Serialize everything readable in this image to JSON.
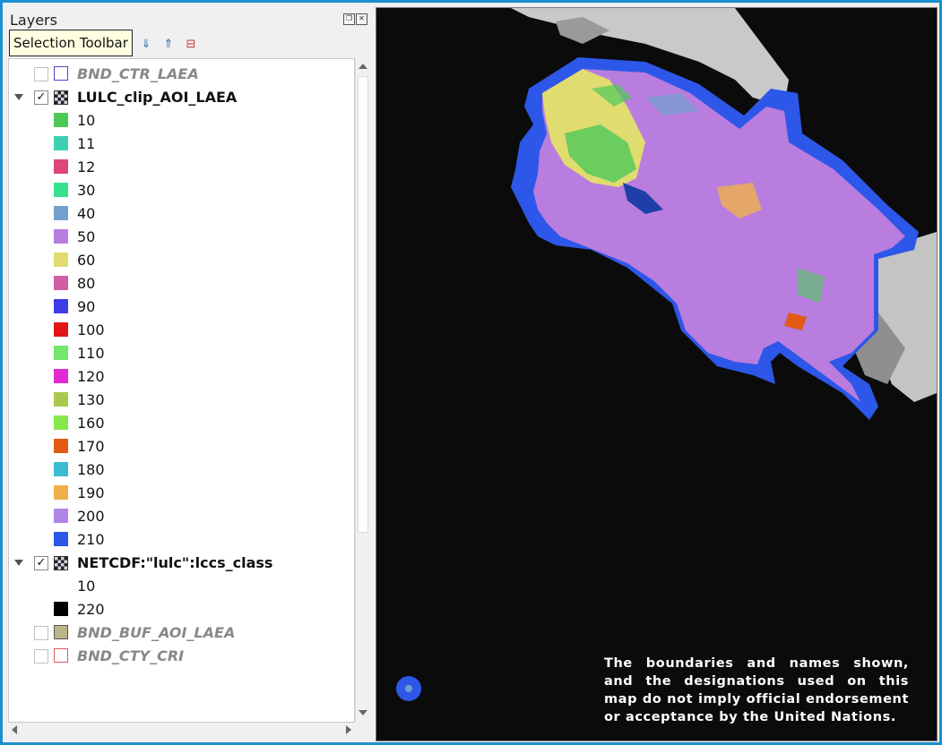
{
  "panel": {
    "title": "Layers",
    "tooltip": "Selection Toolbar"
  },
  "layers": {
    "bnd_ctr": {
      "name": "BND_CTR_LAEA",
      "checked": false,
      "symbol_color": "#5b3fd0"
    },
    "lulc": {
      "name": "LULC_clip_AOI_LAEA",
      "checked": true,
      "classes": [
        {
          "label": "10",
          "color": "#4dc95a"
        },
        {
          "label": "11",
          "color": "#3fcfb2"
        },
        {
          "label": "12",
          "color": "#de4676"
        },
        {
          "label": "30",
          "color": "#37e08c"
        },
        {
          "label": "40",
          "color": "#74a0cf"
        },
        {
          "label": "50",
          "color": "#b87ddf"
        },
        {
          "label": "60",
          "color": "#e0dc6f"
        },
        {
          "label": "80",
          "color": "#d15da3"
        },
        {
          "label": "90",
          "color": "#3f3de8"
        },
        {
          "label": "100",
          "color": "#e11515"
        },
        {
          "label": "110",
          "color": "#74e66a"
        },
        {
          "label": "120",
          "color": "#e22ad3"
        },
        {
          "label": "130",
          "color": "#a9c94c"
        },
        {
          "label": "160",
          "color": "#87e84b"
        },
        {
          "label": "170",
          "color": "#e25a16"
        },
        {
          "label": "180",
          "color": "#3cbbd3"
        },
        {
          "label": "190",
          "color": "#efb04b"
        },
        {
          "label": "200",
          "color": "#b184e7"
        },
        {
          "label": "210",
          "color": "#2b57e8"
        }
      ]
    },
    "netcdf": {
      "name": "NETCDF:\"lulc\":lccs_class",
      "checked": true,
      "classes": [
        {
          "label": "10",
          "color": "#ffffff"
        },
        {
          "label": "220",
          "color": "#000000"
        }
      ]
    },
    "bnd_buf": {
      "name": "BND_BUF_AOI_LAEA",
      "checked": false,
      "symbol_color": "#bdb58a"
    },
    "bnd_cty": {
      "name": "BND_CTY_CRI",
      "checked": false,
      "symbol_color": "#e05a5a"
    }
  },
  "map": {
    "disclaimer": "The boundaries and names shown, and the designations used on this map do not imply official endorsement or acceptance by the United Nations."
  }
}
